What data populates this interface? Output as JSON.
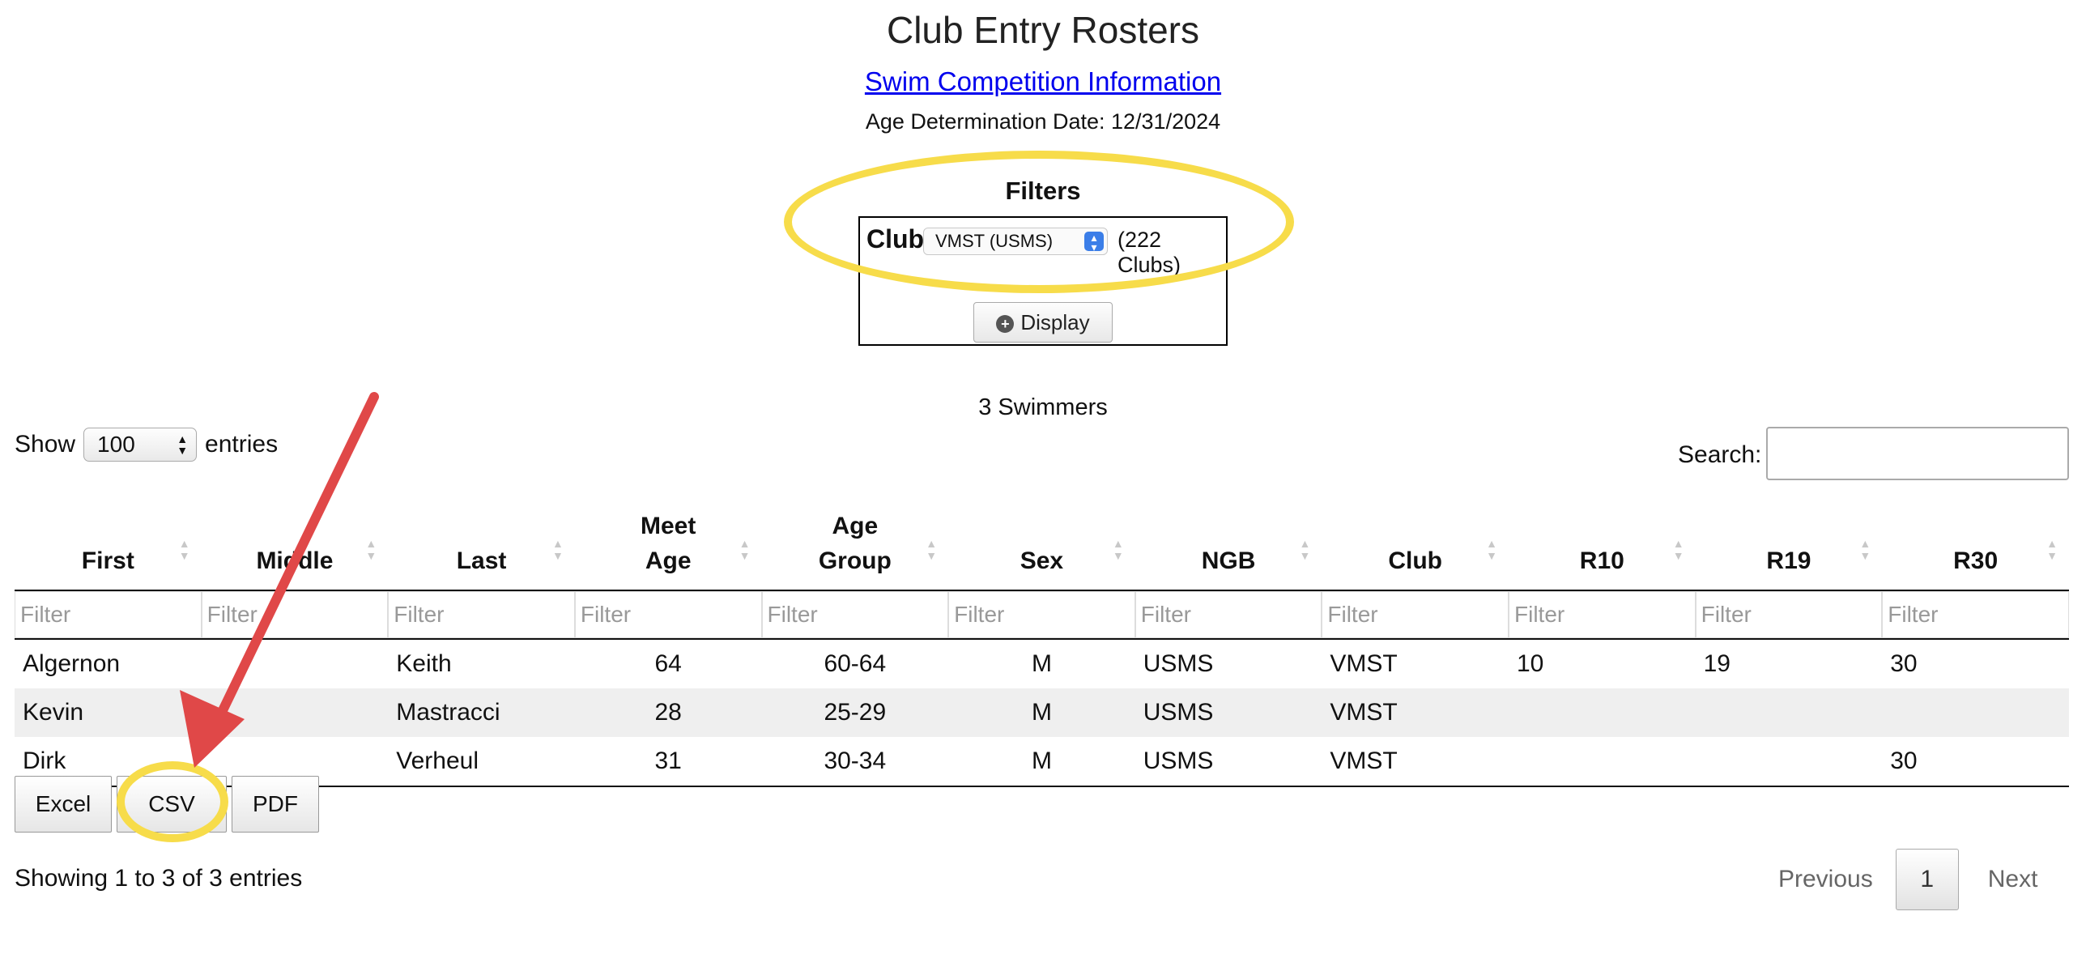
{
  "header": {
    "title": "Club Entry Rosters",
    "competition_link": "Swim Competition Information",
    "age_determination": "Age Determination Date: 12/31/2024"
  },
  "filters": {
    "title": "Filters",
    "club_label": "Club",
    "club_value": "VMST (USMS)",
    "club_count": "(222 Clubs)",
    "display_button": "Display"
  },
  "summary": {
    "swimmers": "3 Swimmers"
  },
  "length": {
    "show": "Show",
    "value": "100",
    "entries": "entries"
  },
  "search": {
    "label": "Search:",
    "value": ""
  },
  "table": {
    "headers": [
      {
        "l1": "",
        "l2": "First"
      },
      {
        "l1": "",
        "l2": "Middle"
      },
      {
        "l1": "",
        "l2": "Last"
      },
      {
        "l1": "Meet",
        "l2": "Age"
      },
      {
        "l1": "Age",
        "l2": "Group"
      },
      {
        "l1": "",
        "l2": "Sex"
      },
      {
        "l1": "",
        "l2": "NGB"
      },
      {
        "l1": "",
        "l2": "Club"
      },
      {
        "l1": "",
        "l2": "R10"
      },
      {
        "l1": "",
        "l2": "R19"
      },
      {
        "l1": "",
        "l2": "R30"
      }
    ],
    "filter_placeholder": "Filter",
    "rows": [
      [
        "Algernon",
        "",
        "Keith",
        "64",
        "60-64",
        "M",
        "USMS",
        "VMST",
        "10",
        "19",
        "30"
      ],
      [
        "Kevin",
        "",
        "Mastracci",
        "28",
        "25-29",
        "M",
        "USMS",
        "VMST",
        "",
        "",
        ""
      ],
      [
        "Dirk",
        "",
        "Verheul",
        "31",
        "30-34",
        "M",
        "USMS",
        "VMST",
        "",
        "",
        "30"
      ]
    ]
  },
  "export_buttons": {
    "excel": "Excel",
    "csv": "CSV",
    "pdf": "PDF"
  },
  "info": "Showing 1 to 3 of 3 entries",
  "pagination": {
    "previous": "Previous",
    "current": "1",
    "next": "Next"
  },
  "annotations": {
    "highlight_color": "#f7dc4a",
    "arrow_color": "#e04848"
  }
}
